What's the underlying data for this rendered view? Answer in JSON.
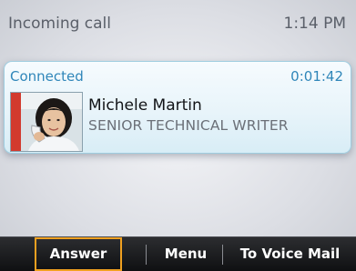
{
  "status_bar": {
    "title": "Incoming call",
    "time": "1:14 PM"
  },
  "call": {
    "state": "Connected",
    "timer": "0:01:42",
    "contact_name": "Michele Martin",
    "contact_title": "SENIOR TECHNICAL WRITER"
  },
  "softkeys": {
    "answer": "Answer",
    "menu": "Menu",
    "voicemail": "To Voice Mail"
  },
  "colors": {
    "accent_blue": "#2f86b9",
    "presence_red": "#d23a2e",
    "focus_orange": "#f0a020"
  }
}
